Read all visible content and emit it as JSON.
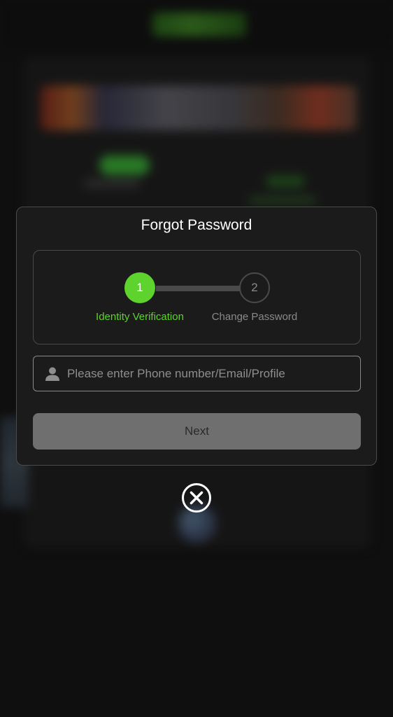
{
  "modal": {
    "title": "Forgot Password",
    "steps": [
      {
        "number": "1",
        "label": "Identity Verification",
        "state": "active"
      },
      {
        "number": "2",
        "label": "Change Password",
        "state": "inactive"
      }
    ],
    "input": {
      "value": "",
      "placeholder": "Please enter Phone number/Email/Profile",
      "icon": "user-icon"
    },
    "next_label": "Next",
    "close_icon": "close-circle-icon"
  },
  "colors": {
    "accent": "#5ed32e",
    "modal_bg": "#1b1b1b",
    "border": "#4a4a4a",
    "button_disabled": "#6f6f6f"
  }
}
